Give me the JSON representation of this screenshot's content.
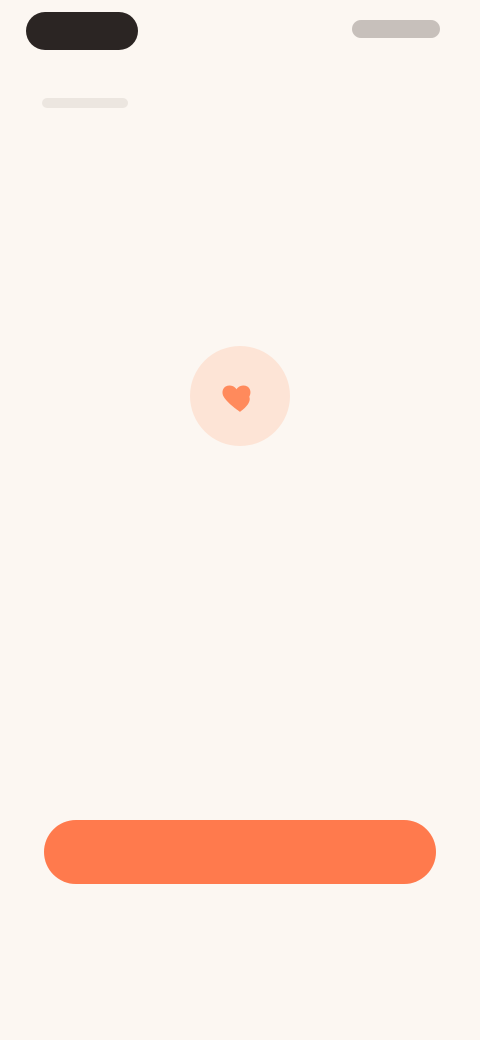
{
  "top_bar": {
    "left_pill_label": "",
    "right_link_label": ""
  },
  "hero": {
    "icon": "heart-icon",
    "icon_color": "#ff8a5c",
    "circle_color": "#fde4d6"
  },
  "content": {
    "title": "",
    "description": ""
  },
  "actions": {
    "primary_label": "",
    "secondary_label": ""
  },
  "colors": {
    "background": "#fcf7f2",
    "accent": "#ff7a4d",
    "text_dark": "#2b2523",
    "text_muted": "#9a918b"
  }
}
